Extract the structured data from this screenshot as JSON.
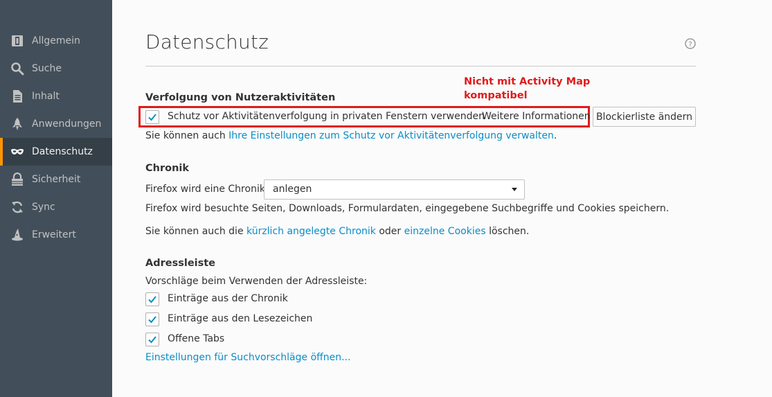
{
  "sidebar": {
    "items": [
      {
        "label": "Allgemein",
        "icon": "general-icon"
      },
      {
        "label": "Suche",
        "icon": "search-icon"
      },
      {
        "label": "Inhalt",
        "icon": "content-icon"
      },
      {
        "label": "Anwendungen",
        "icon": "applications-icon"
      },
      {
        "label": "Datenschutz",
        "icon": "mask-icon",
        "active": true
      },
      {
        "label": "Sicherheit",
        "icon": "lock-icon"
      },
      {
        "label": "Sync",
        "icon": "sync-icon"
      },
      {
        "label": "Erweitert",
        "icon": "wizard-hat-icon"
      }
    ]
  },
  "page": {
    "title": "Datenschutz"
  },
  "tracking": {
    "heading": "Verfolgung von Nutzeraktivitäten",
    "checkbox_label": "Schutz vor Aktivitätenverfolgung in privaten Fenstern verwenden",
    "checkbox_checked": true,
    "more_info_link": "Weitere Informationen",
    "blocklist_button": "Blockierliste ändern",
    "note_prefix": "Sie können auch ",
    "note_link": "Ihre Einstellungen zum Schutz vor Aktivitätenverfolgung verwalten",
    "note_suffix": "."
  },
  "annotation": {
    "line1": "Nicht mit Activity Map",
    "line2": "kompatibel",
    "color": "#e21a1a"
  },
  "history": {
    "heading": "Chronik",
    "select_label": "Firefox wird eine Chronik:",
    "select_value": "anlegen",
    "description": "Firefox wird besuchte Seiten, Downloads, Formulardaten, eingegebene Suchbegriffe und Cookies speichern.",
    "clear_prefix": "Sie können auch die ",
    "clear_link1": "kürzlich angelegte Chronik",
    "clear_middle": " oder ",
    "clear_link2": "einzelne Cookies",
    "clear_suffix": " löschen."
  },
  "addressbar": {
    "heading": "Adressleiste",
    "intro": "Vorschläge beim Verwenden der Adressleiste:",
    "options": [
      {
        "label": "Einträge aus der Chronik",
        "checked": true
      },
      {
        "label": "Einträge aus den Lesezeichen",
        "checked": true
      },
      {
        "label": "Offene Tabs",
        "checked": true
      }
    ],
    "settings_link": "Einstellungen für Suchvorschläge öffnen..."
  },
  "colors": {
    "sidebar_bg": "#424f5a",
    "accent": "#ff9500",
    "link": "#0a8dc8"
  }
}
